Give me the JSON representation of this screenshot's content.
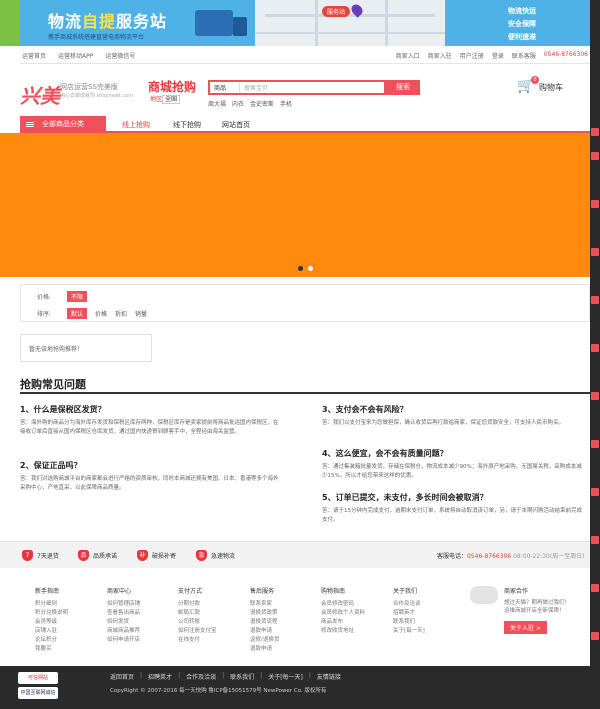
{
  "banner": {
    "title_a": "物流",
    "title_b": "自提",
    "title_c": "服务站",
    "subtitle": "携手商城系统搭建直营电商物流平台",
    "map_label": "服务站",
    "badges": [
      "物流快运",
      "安全保障",
      "便利速递"
    ]
  },
  "topbar": {
    "left": [
      "运营首页",
      "运营移动APP",
      "运营微信号"
    ],
    "right": [
      "商家入口",
      "商家入驻",
      "用户注册",
      "登录",
      "联系客服",
      "0546-8766306"
    ]
  },
  "header": {
    "logo": "兴美",
    "logo_sub": "网店运营SS完美版",
    "logo_url": "用心去做成就你 shopnewt.com",
    "sale_title": "商城抢购",
    "region_label": "地区",
    "region_value": "全国",
    "search_scope": "商品",
    "search_placeholder": "搜索宝贝",
    "search_button": "搜索",
    "hotwords": [
      "周大福",
      "内衣",
      "金史密斯",
      "手机"
    ],
    "cart_label": "购物车",
    "cart_count": "0"
  },
  "nav": {
    "all": "全部商品分类",
    "items": [
      "线上抢购",
      "线下抢购",
      "网站首页"
    ]
  },
  "colors": {
    "brand": "#f0505a",
    "hero": "#ff8a0d"
  },
  "filter": {
    "price_label": "价格:",
    "price_tag": "不限",
    "sort_label": "排序:",
    "sort_options": [
      "默认",
      "价格",
      "折扣",
      "销量"
    ]
  },
  "empty_text": "暂无该地抢购推荐！",
  "faq": {
    "title": "抢购常见问题",
    "items": [
      {
        "q": "1、什么是保税区发货？",
        "a": "答：海外购的商品分为海外库存发货和保税区库存两种，保税区库存是卖家提前将商品批运国内保税区，在接收订单后直接从国内保税区仓库发货，通过国内快递寄到顾客手中，全程经由海关监管。"
      },
      {
        "q": "2、保证正品吗？",
        "a": "答：我们对选购商城平台的商家都会进行严格的资质审核，同时本商城还拥有美国、日本、香港等多个海外采购中心，产地直采，以此保障商品质量。"
      },
      {
        "q": "3、支付会不会有风险？",
        "a": "答：我们以支付宝来为您做担保，确认收货后再打款给商家，保证您货款安全，可支持人民币购买。"
      },
      {
        "q": "4、这么便宜，会不会有质量问题？",
        "a": "答：通过集装箱批量发货，存储在保税仓，物流成本减少90%；海外原产地采购，无国易关税，采购成本减少15%，所以才给您带来这样的优惠。"
      },
      {
        "q": "5、订单已提交，未支付，多长时间会被取消？",
        "a": "答：请于15分钟内完成支付，逾期未支付订单，系统将自动取消该订单，另，请于本期闪购活动结束前完成支付。"
      }
    ]
  },
  "services": [
    "7天退货",
    "品质承诺",
    "破损补寄",
    "急速物流"
  ],
  "service_icons": [
    "7",
    "品",
    "补",
    "急"
  ],
  "hotline": {
    "label": "客服电话：",
    "number": "0546-8766306",
    "hours": "08:00-22:30(周一至周日)"
  },
  "footer_cols": [
    {
      "h": "新手指南",
      "links": [
        "积分细则",
        "积分兑换说明",
        "会员等级",
        "店铺入驻",
        "论坛积分",
        "我要买"
      ]
    },
    {
      "h": "商家中心",
      "links": [
        "如何管理店铺",
        "查看售出商品",
        "如何发货",
        "商城商品推荐",
        "如何申请开店"
      ]
    },
    {
      "h": "支付方式",
      "links": [
        "分期付款",
        "邮局汇款",
        "公司转账",
        "如何注册支付宝",
        "在线支付"
      ]
    },
    {
      "h": "售后服务",
      "links": [
        "联系卖家",
        "退换货政策",
        "退换货流程",
        "退款申请",
        "返修/退换货",
        "退款申请"
      ]
    },
    {
      "h": "购物指南",
      "links": [
        "会员修改密码",
        "会员修改个人资料",
        "商品发布",
        "修改收货地址"
      ]
    },
    {
      "h": "关于我们",
      "links": [
        "合作及洽谈",
        "招聘英才",
        "联系我们",
        "关于[每一天]"
      ]
    }
  ],
  "partner": {
    "h": "商家合作",
    "desc1": "想过天猫？期再做过我们！",
    "desc2": "运维商城开店全新保障！",
    "button": "关于入驻 >"
  },
  "bottom": {
    "badge1": "可信网站",
    "badge2": "中国互联网诚信",
    "links": [
      "返回首页",
      "招聘英才",
      "合作及洽谈",
      "联系我们",
      "关于[每一天]",
      "友情链接"
    ],
    "copyright": "CopyRight © 2007-2016 每一天快购 鲁ICP备15051579号 NewPower Co. 版权所有"
  }
}
